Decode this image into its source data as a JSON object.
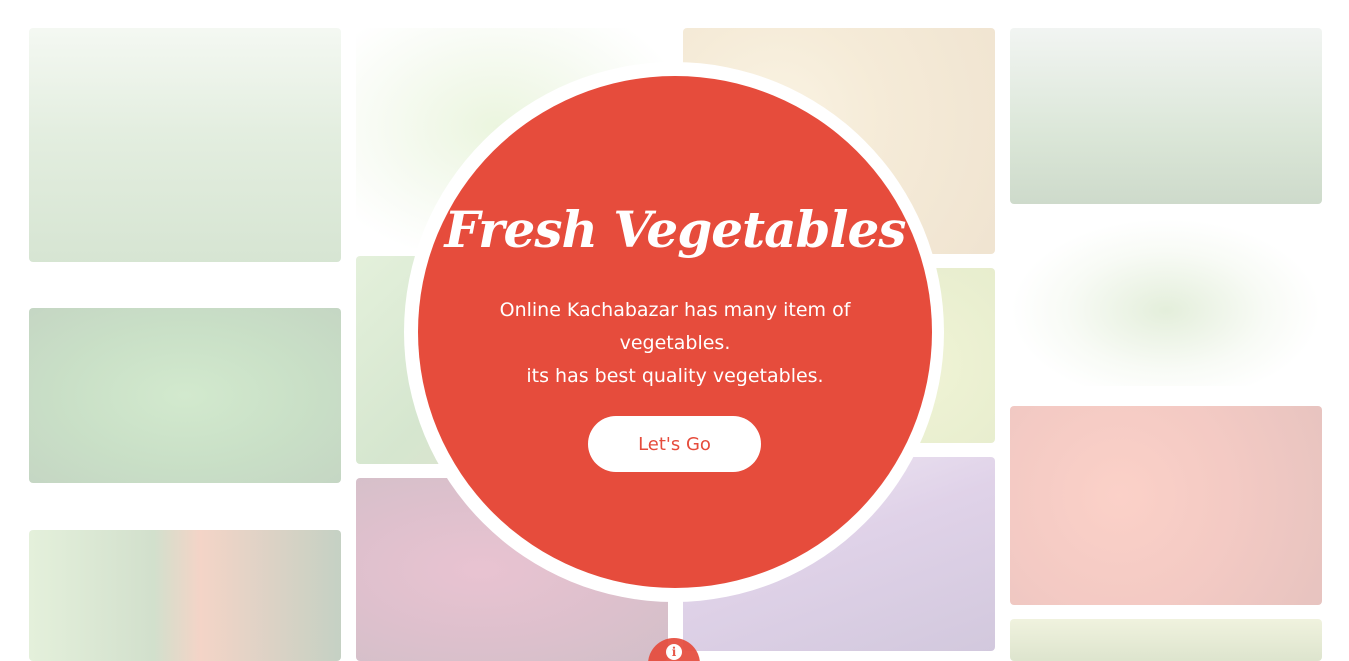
{
  "hero": {
    "title": "Fresh Vegetables",
    "line1": "Online Kachabazar has many item of vegetables.",
    "line2": "its has best quality vegetables.",
    "cta_label": "Let's Go"
  },
  "gallery": [
    {
      "icon": "bottle-gourd-photo"
    },
    {
      "icon": "leafy-greens-photo"
    },
    {
      "icon": "potatoes-photo"
    },
    {
      "icon": "market-greens-photo"
    },
    {
      "icon": "green-chili-photo"
    },
    {
      "icon": "peas-photo"
    },
    {
      "icon": "lemons-photo"
    },
    {
      "icon": "long-beans-photo"
    },
    {
      "icon": "capsicum-photo"
    },
    {
      "icon": "red-spinach-photo"
    },
    {
      "icon": "eggplant-photo"
    },
    {
      "icon": "tomatoes-photo"
    },
    {
      "icon": "cucumber-photo"
    }
  ],
  "info": {
    "icon": "info-icon",
    "glyph": "i"
  },
  "colors": {
    "accent": "#e64c3c",
    "background": "#ffffff"
  }
}
